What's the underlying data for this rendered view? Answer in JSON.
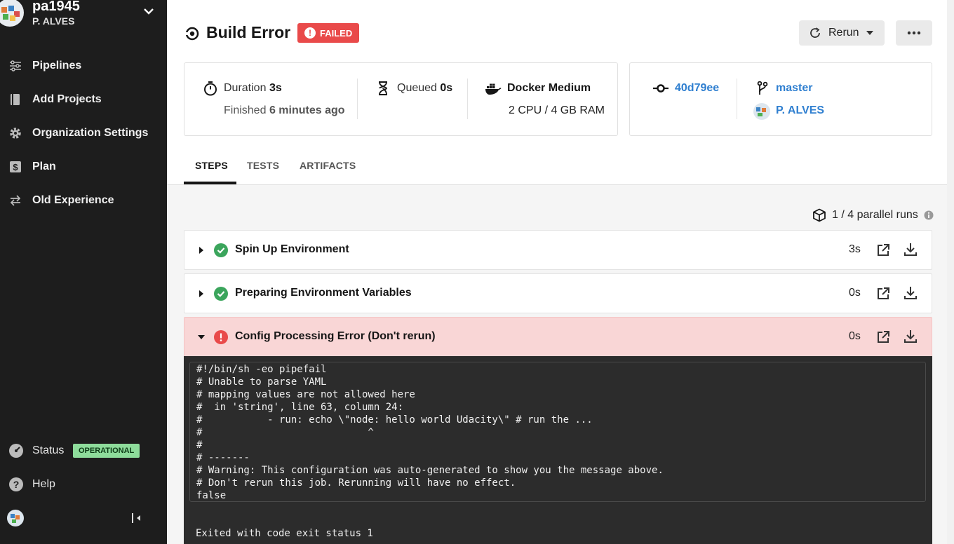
{
  "org": {
    "name": "pa1945",
    "subname": "P. ALVES"
  },
  "nav": [
    {
      "id": "pipelines",
      "label": "Pipelines",
      "icon": "pipelines-icon"
    },
    {
      "id": "add-projects",
      "label": "Add Projects",
      "icon": "book-icon"
    },
    {
      "id": "org-settings",
      "label": "Organization Settings",
      "icon": "gear-icon"
    },
    {
      "id": "plan",
      "label": "Plan",
      "icon": "dollar-icon"
    },
    {
      "id": "old-experience",
      "label": "Old Experience",
      "icon": "swap-icon"
    }
  ],
  "sidebar_bottom": {
    "status_label": "Status",
    "status_badge": "OPERATIONAL",
    "help_label": "Help"
  },
  "job": {
    "title": "Build Error",
    "status": "FAILED",
    "rerun_label": "Rerun",
    "duration_label": "Duration",
    "duration_value": "3s",
    "finished_label": "Finished",
    "finished_value": "6 minutes ago",
    "queued_label": "Queued",
    "queued_value": "0s",
    "executor": "Docker Medium",
    "resources": "2 CPU / 4 GB RAM",
    "commit": "40d79ee",
    "branch": "master",
    "author": "P. ALVES"
  },
  "tabs": [
    "STEPS",
    "TESTS",
    "ARTIFACTS"
  ],
  "parallel_runs": "1 / 4 parallel runs",
  "steps": [
    {
      "name": "Spin Up Environment",
      "duration": "3s",
      "status": "success"
    },
    {
      "name": "Preparing Environment Variables",
      "duration": "0s",
      "status": "success"
    },
    {
      "name": "Config Processing Error (Don't rerun)",
      "duration": "0s",
      "status": "error"
    }
  ],
  "console": {
    "output": "#!/bin/sh -eo pipefail\n# Unable to parse YAML\n# mapping values are not allowed here\n#  in 'string', line 63, column 24:\n#           - run: echo \\\"node: hello world Udacity\\\" # run the ... \n#                            ^\n#\n# -------\n# Warning: This configuration was auto-generated to show you the message above.\n# Don't rerun this job. Rerunning will have no effect.\nfalse",
    "exit": "Exited with code exit status 1"
  },
  "colors": {
    "sidebar": "#1d1d1d",
    "failed": "#e94a4a",
    "success": "#3ba55c",
    "link": "#2f7fd0",
    "error_row": "#f9d6d6",
    "console": "#2c2c2c",
    "operational": "#8edc9b"
  }
}
